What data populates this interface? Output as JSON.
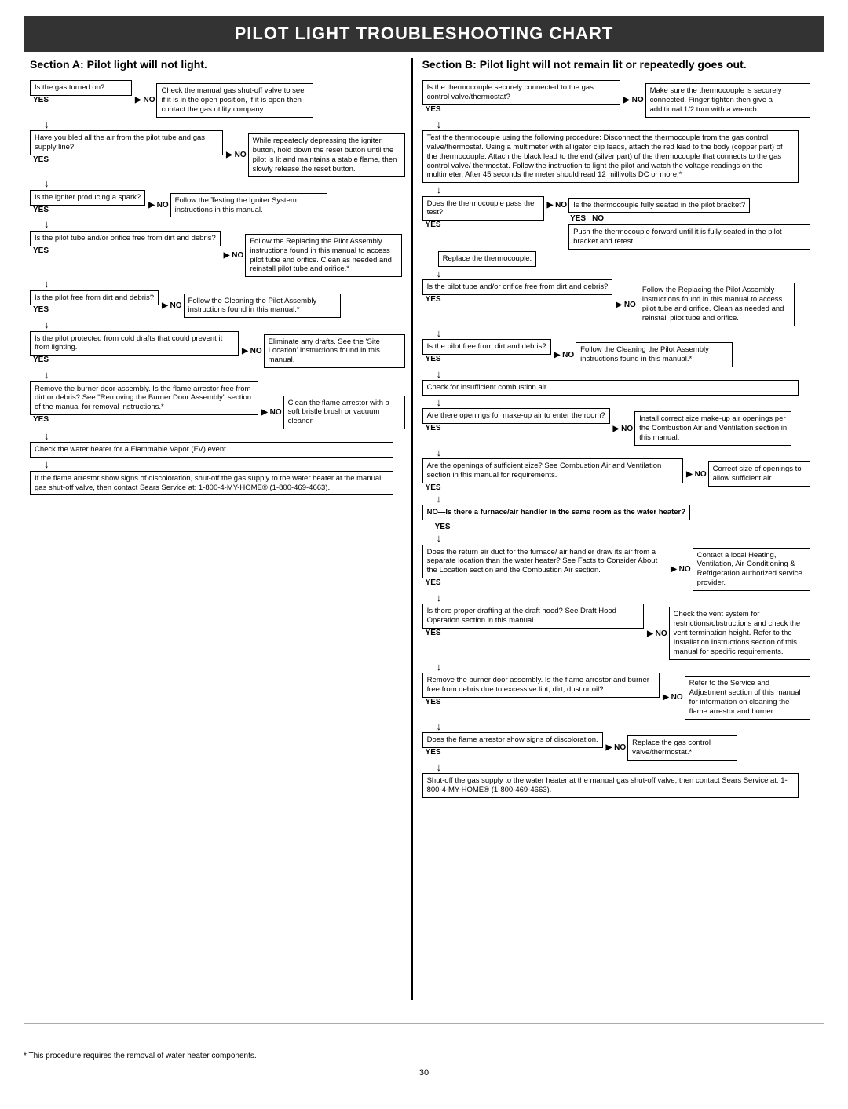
{
  "title": "PILOT LIGHT TROUBLESHOOTING CHART",
  "sectionA": {
    "title": "Section A: Pilot light will not light.",
    "nodes": {
      "q1": "Is the gas turned on?",
      "q1_no": "Check the manual gas shut-off valve to see if it is in the open position, if it is open then contact the gas utility company.",
      "q1_yes": "YES",
      "q2": "Have you bled all the air from the pilot tube and gas supply line?",
      "q2_no": "While repeatedly depressing the igniter button, hold down the reset button until the pilot is lit and maintains a stable flame, then slowly release the reset button.",
      "q2_yes": "YES",
      "q3": "Is the igniter producing a spark?",
      "q3_no": "Follow the Testing the Igniter System instructions in this manual.",
      "q3_yes": "YES",
      "q4": "Is the pilot tube and/or orifice free from dirt and debris?",
      "q4_no": "Follow the Replacing the Pilot Assembly instructions found in this manual to access pilot tube and orifice. Clean as needed and reinstall pilot tube and orifice.*",
      "q4_yes": "YES",
      "q5": "Is the pilot free from dirt and debris?",
      "q5_no": "Follow the Cleaning the Pilot Assembly instructions found in this manual.*",
      "q5_yes": "YES",
      "q6": "Is the pilot protected from cold drafts that could prevent it from lighting.",
      "q6_no": "Eliminate any drafts. See the 'Site Location' instructions found in this manual.",
      "q6_yes": "YES",
      "q7": "Remove the burner door assembly. Is the flame arrestor free from dirt or debris? See \"Removing the Burner Door Assembly\" section of the manual for removal instructions.*",
      "q7_no": "Clean the flame arrestor with a soft bristle brush or vacuum cleaner.",
      "q7_yes": "YES",
      "q8": "Check the water heater for a Flammable Vapor (FV) event.",
      "q9": "If the flame arrestor show signs of discoloration, shut-off the gas supply to the water heater at the manual gas shut-off valve, then contact Sears Service at: 1-800-4-MY-HOME® (1-800-469-4663)."
    }
  },
  "sectionB": {
    "title": "Section B: Pilot light will not remain lit or repeatedly goes out.",
    "nodes": {
      "q1": "Is the thermocouple securely connected to the gas control valve/thermostat?",
      "q1_no": "Make sure the thermocouple is securely connected. Finger tighten then give a additional 1/2 turn with a wrench.",
      "q1_yes": "YES",
      "q2_long": "Test the thermocouple using the following procedure: Disconnect the thermocouple from the gas control valve/thermostat. Using a multimeter with alligator clip leads, attach the red lead to the body (copper part) of the thermocouple. Attach the black lead to the end (silver part) of the thermocouple that connects to the gas control valve/ thermostat. Follow the instruction to light the pilot and watch the voltage readings on the multimeter. After 45 seconds the meter should read 12 millivolts DC or more.*",
      "q3": "Does the thermocouple pass the test?",
      "q3_no_q": "Is the thermocouple fully seated in the pilot bracket?",
      "q3_no_q_yes": "YES",
      "q3_no_q_no": "NO",
      "q3_no_q_no_action": "Push the thermocouple forward until it is fully seated in the pilot bracket and retest.",
      "q3_yes": "YES",
      "q3_replace": "Replace the thermocouple.",
      "q4": "Is the pilot tube and/or orifice free from dirt and debris?",
      "q4_no": "Follow the Replacing the Pilot Assembly instructions found in this manual to access pilot tube and orifice. Clean as needed and reinstall pilot tube and orifice.",
      "q4_yes": "YES",
      "q5": "Is the pilot free from dirt and debris?",
      "q5_no": "Follow the Cleaning the Pilot Assembly instructions found in this manual.*",
      "q5_yes": "YES",
      "q6": "Check for insufficient combustion air.",
      "q7": "Are there openings for make-up air to enter the room?",
      "q7_no": "Install correct size make-up air openings per the Combustion Air and Ventilation section in this manual.",
      "q7_yes": "YES",
      "q8": "Are the openings of sufficient size? See Combustion Air and Ventilation section in this manual for requirements.",
      "q8_no": "Correct size of openings to allow sufficient air.",
      "q8_yes": "YES",
      "q9": "NO—Is there a furnace/air handler in the same room as the water heater?",
      "q9_yes": "YES",
      "q10": "Does the return air duct for the furnace/ air handler draw its air from a separate location than the water heater? See Facts to Consider About the Location section and the Combustion Air section.",
      "q10_no": "Contact a local Heating, Ventilation, Air-Conditioning & Refrigeration authorized service provider.",
      "q10_yes": "YES",
      "q11": "Is there proper drafting at the draft hood? See Draft Hood Operation section in this manual.",
      "q11_no": "Check the vent system for restrictions/obstructions and check the vent termination height. Refer to the Installation Instructions section of this manual for specific requirements.",
      "q11_yes": "YES",
      "q12": "Remove the burner door assembly. Is the flame arrestor and burner free from debris due to excessive lint, dirt, dust or oil?",
      "q12_no": "Refer to the Service and Adjustment section of this manual for information on cleaning the flame arrestor and burner.",
      "q12_yes": "YES",
      "q13": "Does the flame arrestor show signs of discoloration.",
      "q13_no": "NO",
      "q13_no_action": "Replace the gas control valve/thermostat.*",
      "q13_yes": "YES",
      "q14": "Shut-off the gas supply to the water heater at the manual gas shut-off valve, then contact Sears Service at: 1-800-4-MY-HOME® (1-800-469-4663)."
    }
  },
  "footer": {
    "note": "* This procedure requires the removal of water heater components.",
    "page": "30"
  },
  "labels": {
    "yes": "YES",
    "no": "NO",
    "no_arrow": "► NO"
  }
}
